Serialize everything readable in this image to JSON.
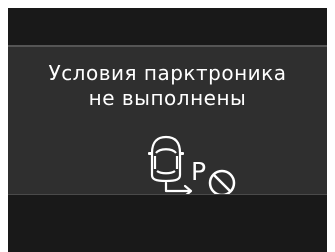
{
  "message": {
    "line1": "Условия парктроника",
    "line2": "не выполнены"
  },
  "icon": {
    "name": "park-assist-unavailable-icon",
    "letter": "P"
  },
  "colors": {
    "panel_background": "#2f2f2f",
    "bar_background": "#191919",
    "text": "#ffffff"
  }
}
